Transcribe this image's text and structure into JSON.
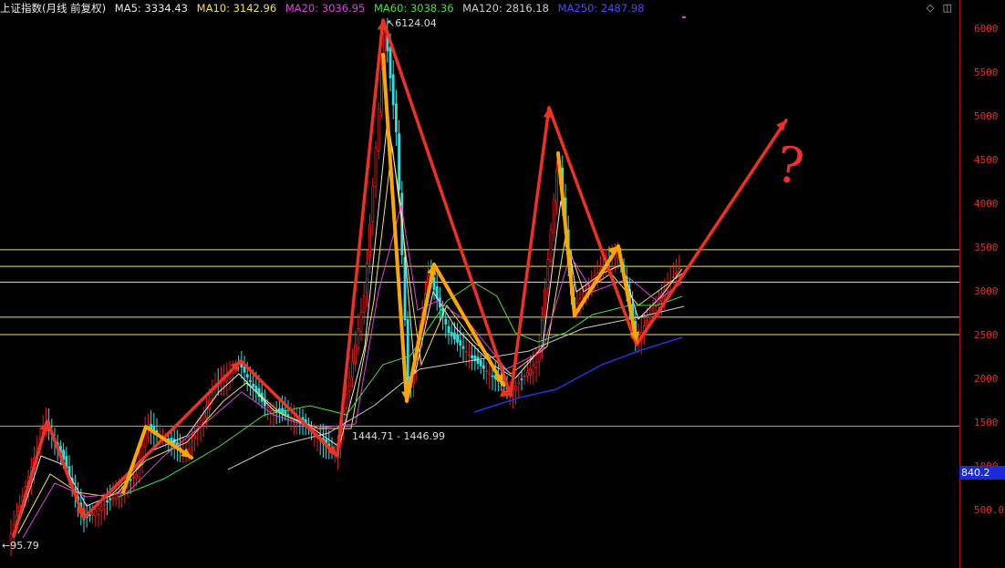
{
  "header": {
    "title": "上证指数(月线 前复权)",
    "ma_items": [
      {
        "label": "MA5: 3334.43",
        "color": "#e8e8e8"
      },
      {
        "label": "MA10: 3142.96",
        "color": "#f0e050"
      },
      {
        "label": "MA20: 3036.95",
        "color": "#e040e0"
      },
      {
        "label": "MA60: 3038.36",
        "color": "#40e040"
      },
      {
        "label": "MA120: 2816.18",
        "color": "#cccccc"
      },
      {
        "label": "MA250: 2487.98",
        "color": "#4040ff"
      }
    ],
    "controls": {
      "diamond": "◇",
      "panel": "◫"
    }
  },
  "axis": {
    "ticks": [
      "6000",
      "5500",
      "5000",
      "4500",
      "4000",
      "3500",
      "3000",
      "2500",
      "2000",
      "1500",
      "1000",
      "500.0"
    ],
    "current_price": "840.2"
  },
  "annotations": {
    "high": "6124.04",
    "low_start": "95.79",
    "mid_low": "1444.71 - 1446.99",
    "question": "?"
  },
  "chart_data": {
    "type": "line",
    "ylim": [
      0,
      6300
    ],
    "horizontal_levels": [
      3480,
      3290,
      3110,
      2710,
      2510,
      1465
    ],
    "key_points": [
      {
        "label": "95.79",
        "y": 95.79
      },
      {
        "label": "6124.04",
        "y": 6124.04
      },
      {
        "label": "1444.71 - 1446.99",
        "y": 1444.71
      }
    ],
    "colors": {
      "up": "#e02020",
      "down": "#30e0e0",
      "red_arrows": "#f03020",
      "orange_arrows": "#ffa500",
      "levels": "#e8e060"
    }
  }
}
